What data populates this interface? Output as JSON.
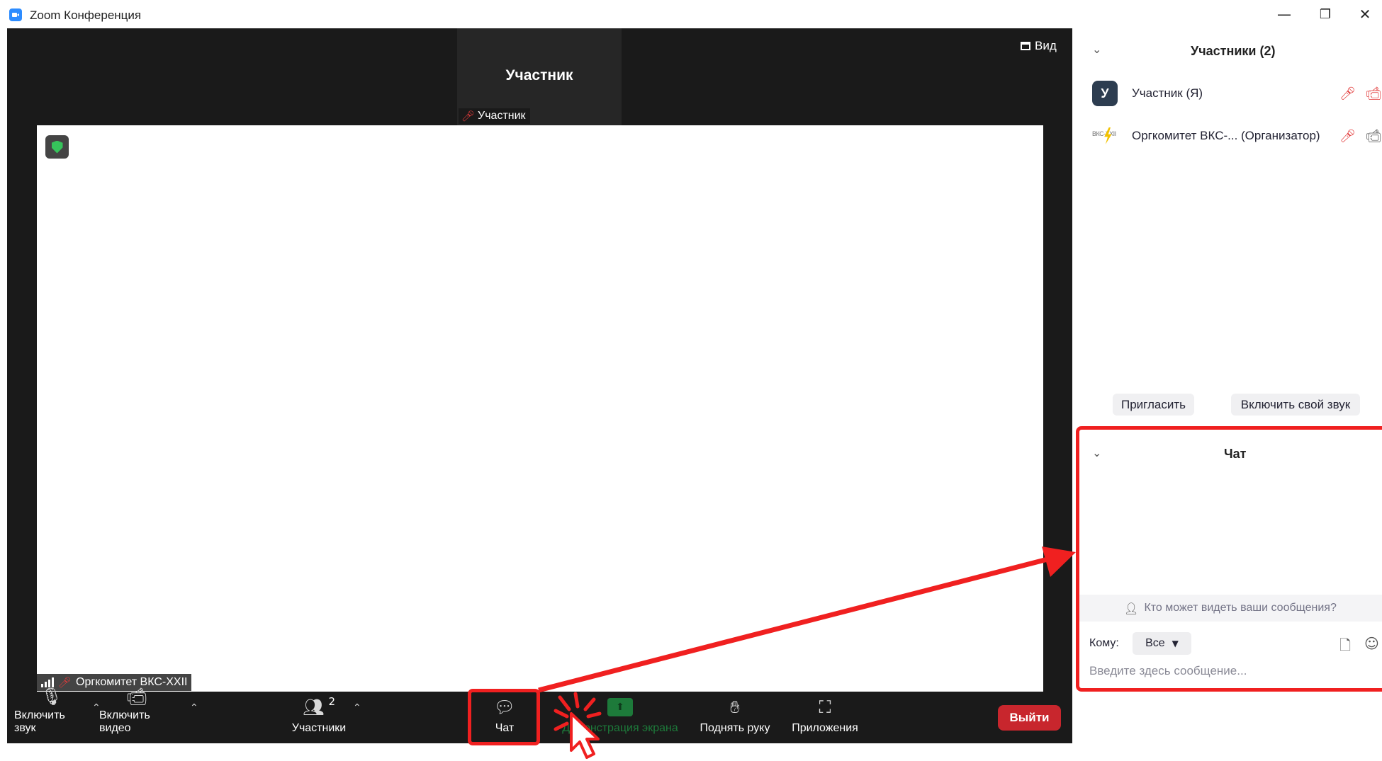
{
  "window": {
    "title": "Zoom Конференция",
    "minimize_glyph": "—",
    "restore_glyph": "❐",
    "close_glyph": "✕"
  },
  "meeting": {
    "view_label": "Вид",
    "thumbnail": {
      "name": "Участник",
      "label": "Участник"
    },
    "share_label": "Оргкомитет ВКС-XXII"
  },
  "toolbar": {
    "unmute_label": "Включить звук",
    "video_label": "Включить видео",
    "participants_label": "Участники",
    "participants_count": "2",
    "chat_label": "Чат",
    "share_label": "Демонстрация экрана",
    "raise_hand_label": "Поднять руку",
    "apps_label": "Приложения",
    "leave_label": "Выйти"
  },
  "participants_panel": {
    "title": "Участники (2)",
    "participants": [
      {
        "avatar": "У",
        "name": "Участник (Я)"
      },
      {
        "avatar_text": "ВКС-XXII",
        "name": "Оргкомитет ВКС-... (Организатор)"
      }
    ],
    "invite_label": "Пригласить",
    "unmute_self_label": "Включить свой звук"
  },
  "chat_panel": {
    "title": "Чат",
    "who_can_see": "Кто может видеть ваши сообщения?",
    "to_label": "Кому:",
    "to_value": "Все",
    "input_placeholder": "Введите здесь сообщение..."
  },
  "colors": {
    "annotation_red": "#f02020",
    "leave_red": "#c8262d",
    "meeting_bg": "#1a1a1a",
    "zoom_blue": "#2d8cff"
  }
}
